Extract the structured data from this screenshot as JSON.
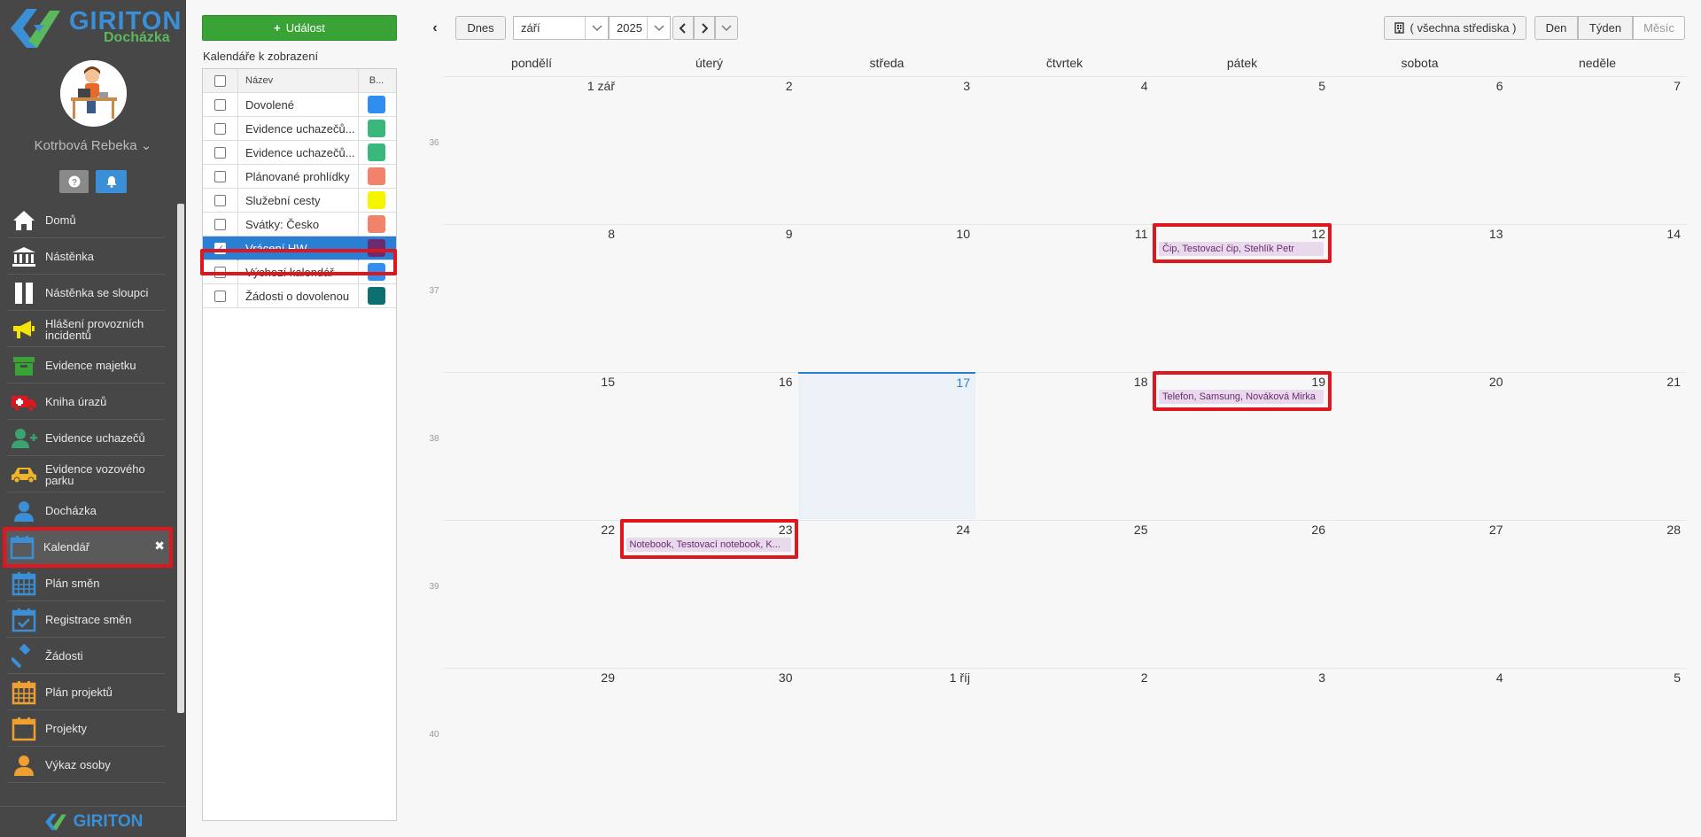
{
  "app": {
    "brand": "GIRITON",
    "subtitle": "Docházka",
    "footer_brand": "GIRITON",
    "user_name": "Kotrbová Rebeka"
  },
  "sidebar": {
    "items": [
      {
        "label": "Domů",
        "icon": "home-icon",
        "color": "#ffffff"
      },
      {
        "label": "Nástěnka",
        "icon": "bank-icon",
        "color": "#ffffff"
      },
      {
        "label": "Nástěnka se sloupci",
        "icon": "columns-icon",
        "color": "#ffffff"
      },
      {
        "label": "Hlášení provozních incidentů",
        "icon": "megaphone-icon",
        "color": "#f5e400"
      },
      {
        "label": "Evidence majetku",
        "icon": "box-icon",
        "color": "#3aa335"
      },
      {
        "label": "Kniha úrazů",
        "icon": "ambulance-icon",
        "color": "#e0161f"
      },
      {
        "label": "Evidence uchazečů",
        "icon": "user-plus-icon",
        "color": "#3aa370"
      },
      {
        "label": "Evidence vozového parku",
        "icon": "car-icon",
        "color": "#f0b429"
      },
      {
        "label": "Docházka",
        "icon": "user-icon",
        "color": "#3a8fd6"
      },
      {
        "label": "Kalendář",
        "icon": "calendar-icon",
        "color": "#3a8fd6"
      },
      {
        "label": "Plán směn",
        "icon": "calendar-grid-icon",
        "color": "#3a8fd6"
      },
      {
        "label": "Registrace směn",
        "icon": "calendar-check-icon",
        "color": "#3a8fd6"
      },
      {
        "label": "Žádosti",
        "icon": "gavel-icon",
        "color": "#3a8fd6"
      },
      {
        "label": "Plán projektů",
        "icon": "calendar-grid-icon",
        "color": "#f0a030"
      },
      {
        "label": "Projekty",
        "icon": "calendar-icon",
        "color": "#f0a030"
      },
      {
        "label": "Výkaz osoby",
        "icon": "user-icon",
        "color": "#f0a030"
      }
    ],
    "close_glyph": "✖"
  },
  "panel": {
    "add_event_label": "Událost",
    "title": "Kalendáře k zobrazení",
    "header_name": "Název",
    "header_color": "B...",
    "calendars": [
      {
        "name": "Dovolené",
        "color": "#2f8ef0",
        "checked": false
      },
      {
        "name": "Evidence uchazečů...",
        "color": "#3ab87c",
        "checked": false
      },
      {
        "name": "Evidence uchazečů...",
        "color": "#3ab87c",
        "checked": false
      },
      {
        "name": "Plánované prohlídky",
        "color": "#f2836b",
        "checked": false
      },
      {
        "name": "Služební cesty",
        "color": "#f5f500",
        "checked": false
      },
      {
        "name": "Svátky: Česko",
        "color": "#f2836b",
        "checked": false
      },
      {
        "name": "Vrácení HW",
        "color": "#6b2b6e",
        "checked": true
      },
      {
        "name": "Výchozí kalendář",
        "color": "#2f8ef0",
        "checked": false
      },
      {
        "name": "Žádosti o dovolenou",
        "color": "#0d7070",
        "checked": false
      }
    ]
  },
  "toolbar": {
    "today_label": "Dnes",
    "month_value": "září",
    "year_value": "2025",
    "center_label": "( všechna střediska )",
    "view_day": "Den",
    "view_week": "Týden",
    "view_month": "Měsíc"
  },
  "calendar": {
    "weekdays": [
      "pondělí",
      "úterý",
      "středa",
      "čtvrtek",
      "pátek",
      "sobota",
      "neděle"
    ],
    "week_numbers": [
      "36",
      "37",
      "38",
      "39",
      "40"
    ],
    "weeks": [
      [
        "1 zář",
        "2",
        "3",
        "4",
        "5",
        "6",
        "7"
      ],
      [
        "8",
        "9",
        "10",
        "11",
        "12",
        "13",
        "14"
      ],
      [
        "15",
        "16",
        "17",
        "18",
        "19",
        "20",
        "21"
      ],
      [
        "22",
        "23",
        "24",
        "25",
        "26",
        "27",
        "28"
      ],
      [
        "29",
        "30",
        "1 říj",
        "2",
        "3",
        "4",
        "5"
      ]
    ],
    "today": {
      "week": 2,
      "day": 2
    },
    "events": [
      {
        "week": 1,
        "day": 4,
        "text": "Čip, Testovací čip, Stehlík Petr"
      },
      {
        "week": 2,
        "day": 4,
        "text": "Telefon, Samsung, Nováková Mirka"
      },
      {
        "week": 3,
        "day": 1,
        "text": "Notebook, Testovací notebook, K..."
      }
    ]
  }
}
